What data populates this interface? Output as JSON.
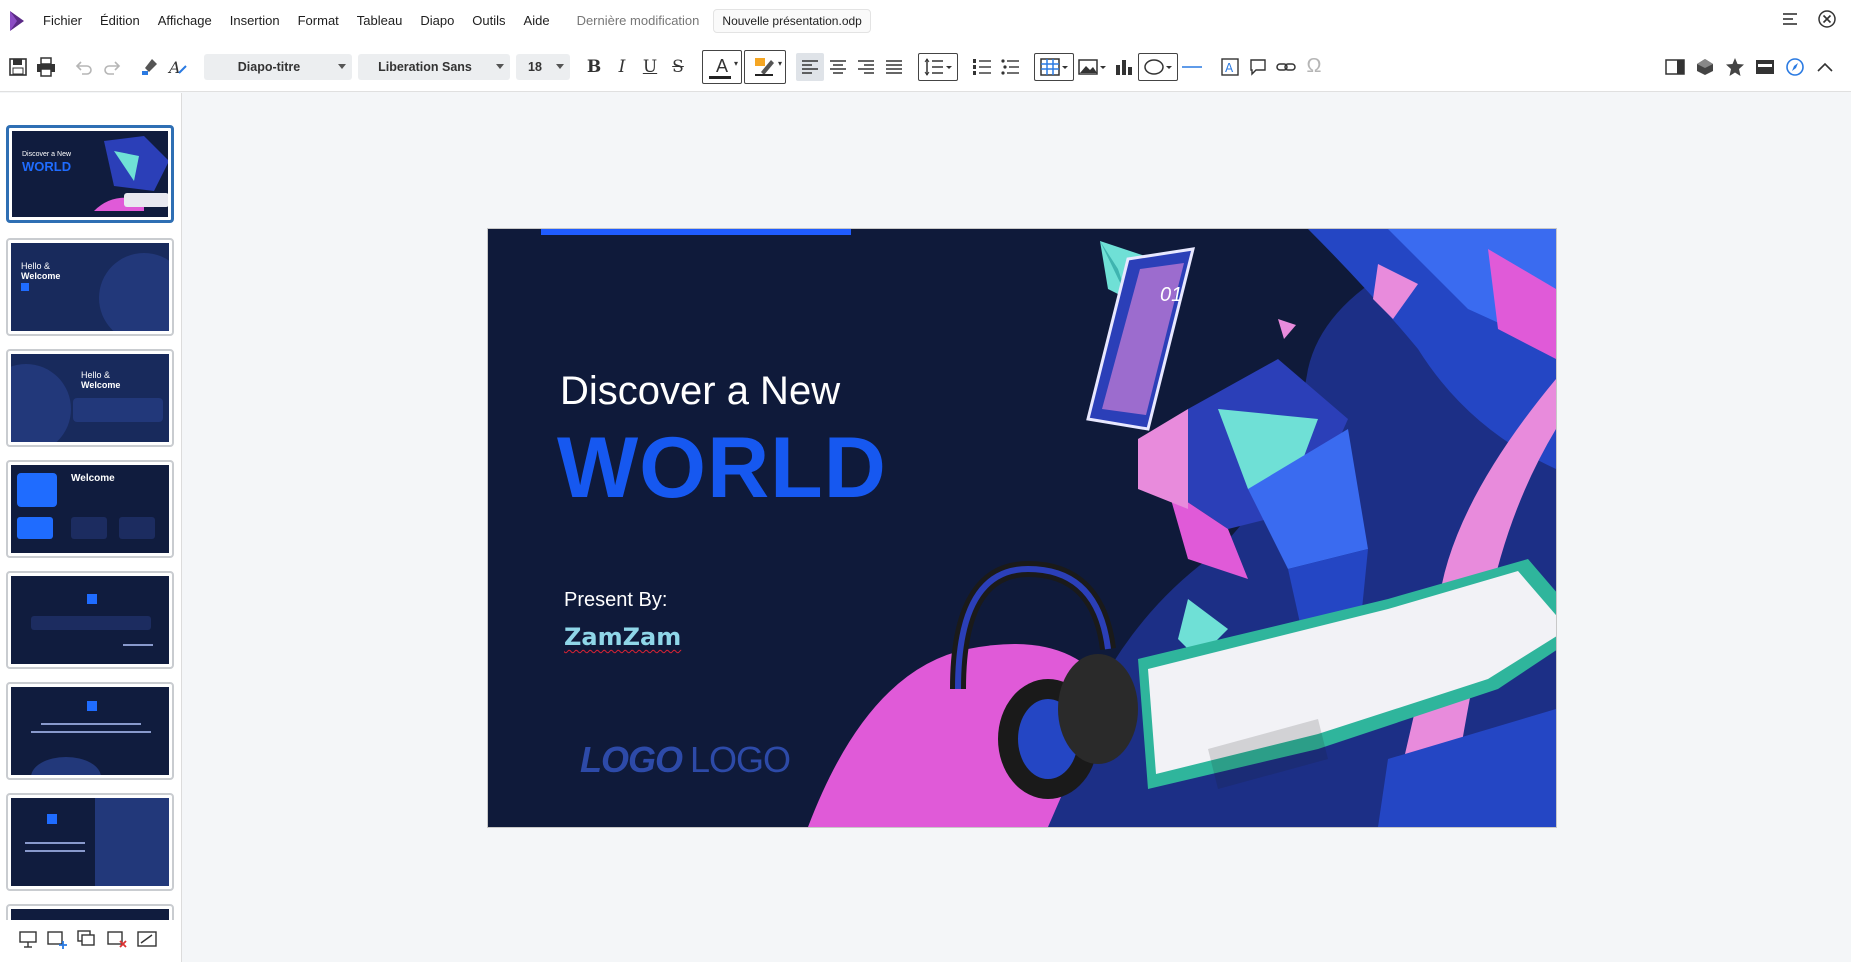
{
  "menubar": {
    "items": [
      "Fichier",
      "Édition",
      "Affichage",
      "Insertion",
      "Format",
      "Tableau",
      "Diapo",
      "Outils",
      "Aide"
    ],
    "last_modified": "Dernière modification",
    "filename": "Nouvelle présentation.odp"
  },
  "toolbar": {
    "style_value": "Diapo-titre",
    "font_value": "Liberation Sans",
    "size_value": "18",
    "bold": "B",
    "italic": "I",
    "underline": "U",
    "strike": "S",
    "font_color_glyph": "A"
  },
  "thumbnails": [
    {
      "line1": "Discover a New",
      "line2": "WORLD"
    },
    {
      "line1": "Hello &",
      "line2": "Welcome"
    },
    {
      "line1": "Hello &",
      "line2": "Welcome"
    },
    {
      "line1": "",
      "line2": "Welcome"
    },
    {
      "line1": "",
      "line2": ""
    },
    {
      "line1": "",
      "line2": ""
    },
    {
      "line1": "",
      "line2": ""
    }
  ],
  "slide": {
    "title_line1": "Discover a New",
    "title_line2": "WORLD",
    "present_by": "Present By:",
    "presenter": "ZamZam",
    "logo1": "LOGO",
    "logo2": "LOGO",
    "phone_text": "01"
  },
  "colors": {
    "slide_bg": "#0f1a3a",
    "accent_blue": "#1658f0",
    "presenter_cyan": "#8fd6e8",
    "magenta": "#e05ad8",
    "teal": "#6fe0d6",
    "active_thumb_border": "#2f6fb4"
  }
}
